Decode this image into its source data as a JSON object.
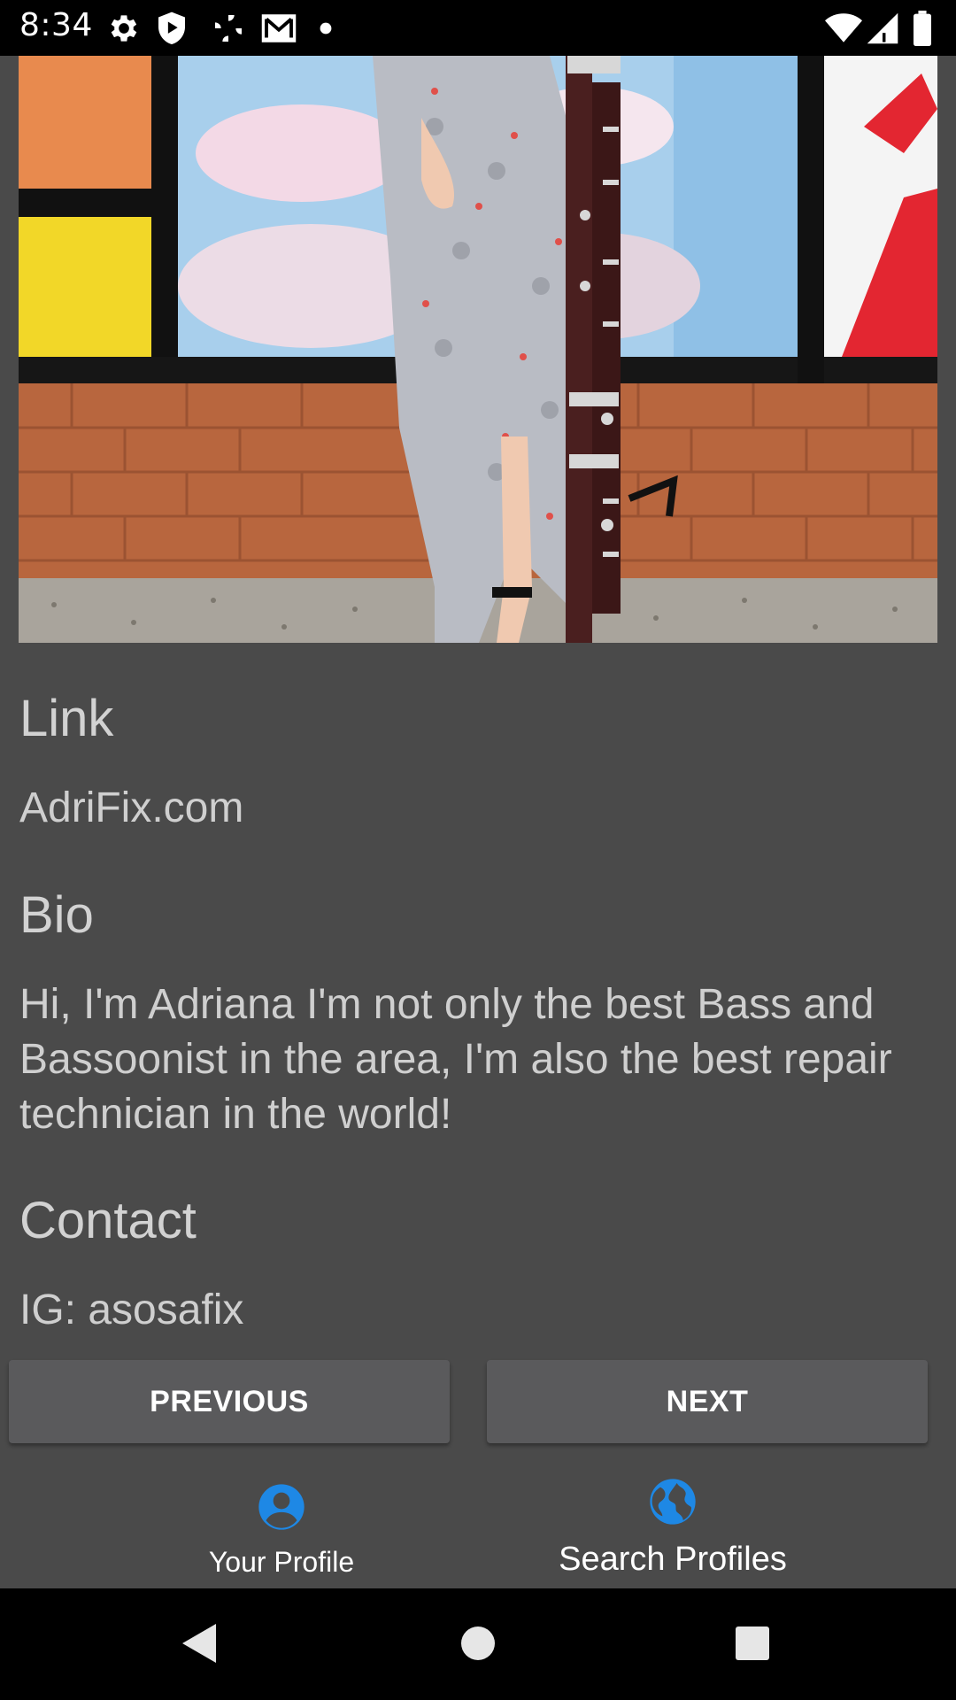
{
  "status_bar": {
    "time": "8:34",
    "icons_left": [
      "gear-icon",
      "shield-play-icon",
      "pinwheel-icon",
      "gmail-icon",
      "notification-dot-icon"
    ],
    "icons_right": [
      "wifi-icon",
      "cell-signal-icon",
      "battery-icon"
    ]
  },
  "profile": {
    "photo": "bassoonist-photo",
    "link_heading": "Link",
    "link_value": "AdriFix.com",
    "bio_heading": "Bio",
    "bio_value": "Hi, I'm Adriana I'm not only the best Bass and Bassoonist in the area, I'm also the best repair technician in the world!",
    "contact_heading": "Contact",
    "contact_value": "IG: asosafix"
  },
  "buttons": {
    "previous": "PREVIOUS",
    "next": "NEXT"
  },
  "bottom_nav": {
    "items": [
      {
        "label": "Your Profile",
        "icon": "account-circle-icon"
      },
      {
        "label": "Search Profiles",
        "icon": "globe-icon"
      }
    ]
  },
  "colors": {
    "background": "#4a4a4a",
    "button": "#5a5a5c",
    "nav_icon": "#1e88e5"
  }
}
